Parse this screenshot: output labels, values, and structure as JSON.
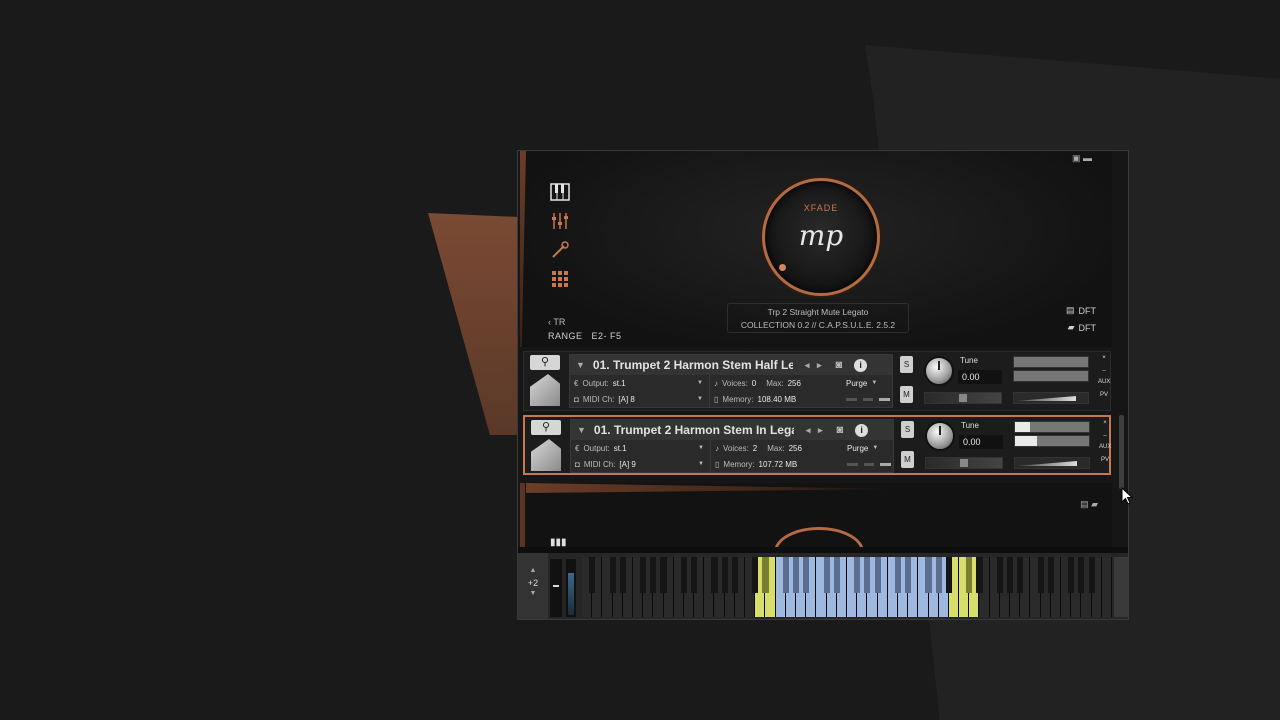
{
  "xfade": {
    "label": "XFADE",
    "value": "mp"
  },
  "preset": {
    "line1": "Trp 2 Straight Mute Legato",
    "line2": "COLLECTION 0.2 // C.A.P.S.U.L.E. 2.5.2"
  },
  "transpose": {
    "label": "TR"
  },
  "range": {
    "label": "RANGE",
    "value": "E2- F5"
  },
  "dft": {
    "label1": "DFT",
    "label2": "DFT"
  },
  "instruments": [
    {
      "name": "01. Trumpet 2 Harmon Stem Half Le",
      "output_label": "Output:",
      "output": "st.1",
      "voices_label": "Voices:",
      "voices": "0",
      "max_label": "Max:",
      "max": "256",
      "purge": "Purge",
      "midi_label": "MIDI Ch:",
      "midi": "[A]  8",
      "memory_label": "Memory:",
      "memory": "108.40 MB",
      "tune_label": "Tune",
      "tune": "0.00",
      "s": "S",
      "m": "M",
      "aux": "AUX",
      "pv": "PV",
      "close": "×",
      "meter_left": 0.0,
      "meter_right": 0.0
    },
    {
      "name": "01. Trumpet 2 Harmon Stem In Lega",
      "output_label": "Output:",
      "output": "st.1",
      "voices_label": "Voices:",
      "voices": "2",
      "max_label": "Max:",
      "max": "256",
      "purge": "Purge",
      "midi_label": "MIDI Ch:",
      "midi": "[A]  9",
      "memory_label": "Memory:",
      "memory": "107.72 MB",
      "tune_label": "Tune",
      "tune": "0.00",
      "s": "S",
      "m": "M",
      "aux": "AUX",
      "pv": "PV",
      "close": "×",
      "meter_left": 0.2,
      "meter_right": 0.3
    }
  ],
  "octave": {
    "value": "+2"
  },
  "keyboard": {
    "white_key_count": 52,
    "yellow_white_keys": [
      17,
      18,
      36,
      37,
      38
    ],
    "blue_white_range": [
      19,
      35
    ],
    "colors": {
      "yellow": "#d8de6a",
      "blue": "#9fb8e0",
      "dark": "#2a2a2a",
      "black": "#151515",
      "black_blue": "#5a6e90",
      "black_yellow": "#7a7e30"
    }
  },
  "colors": {
    "accent": "#c8784c"
  }
}
